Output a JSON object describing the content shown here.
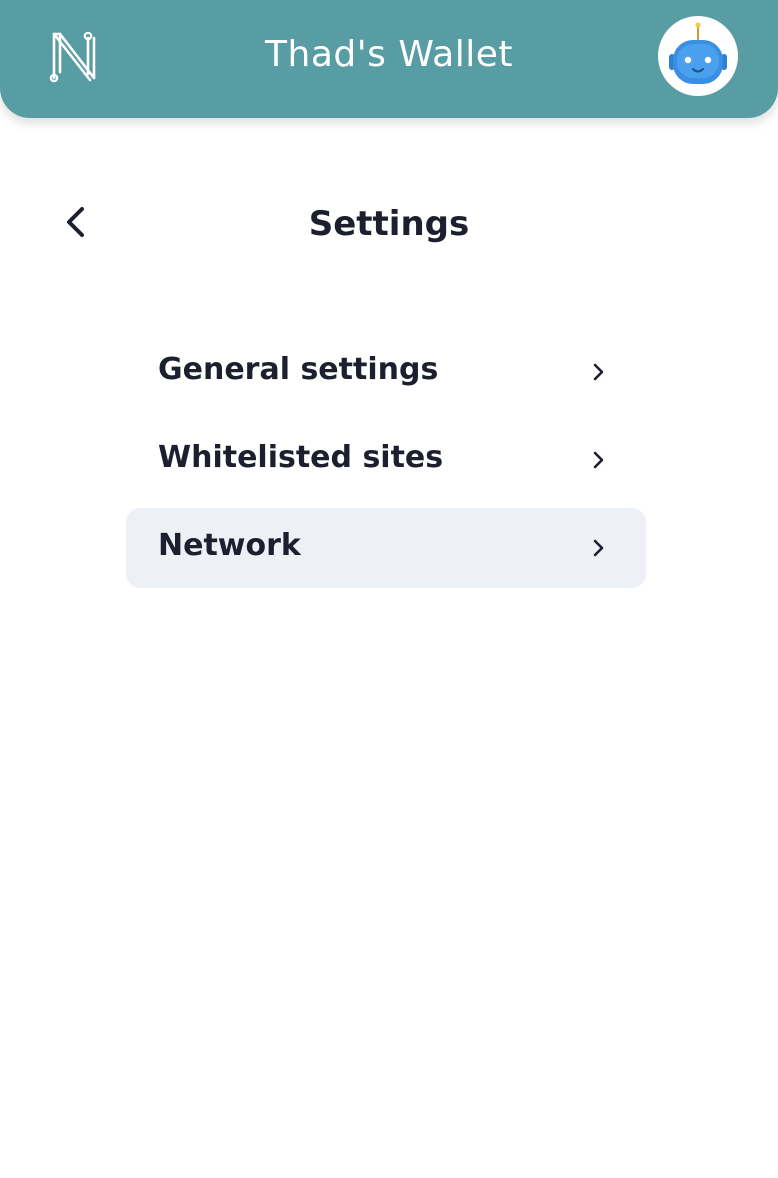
{
  "header": {
    "title": "Thad's Wallet",
    "logo_icon": "n-logo-icon",
    "avatar_icon": "robot-avatar-icon",
    "background_color": "#589da3"
  },
  "page": {
    "title": "Settings",
    "back_icon": "chevron-left-icon"
  },
  "menu": {
    "items": [
      {
        "label": "General settings",
        "icon": "chevron-right-icon",
        "active": false
      },
      {
        "label": "Whitelisted sites",
        "icon": "chevron-right-icon",
        "active": false
      },
      {
        "label": "Network",
        "icon": "chevron-right-icon",
        "active": true
      }
    ],
    "active_background": "#edf0f4"
  }
}
